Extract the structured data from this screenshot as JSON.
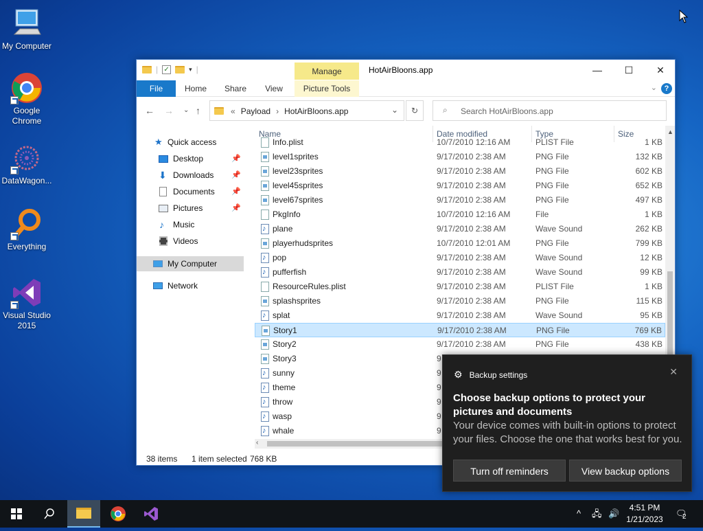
{
  "desktop": {
    "icons": [
      {
        "label": "My Computer",
        "icon": "computer-icon"
      },
      {
        "label": "Google Chrome",
        "icon": "chrome-icon"
      },
      {
        "label": "DataWagon...",
        "icon": "datawagon-icon"
      },
      {
        "label": "Everything",
        "icon": "everything-search-icon"
      },
      {
        "label": "Visual Studio 2015",
        "icon": "visual-studio-icon"
      }
    ]
  },
  "window": {
    "title": "HotAirBloons.app",
    "context_tab": "Manage",
    "ribbon_tabs": [
      "File",
      "Home",
      "Share",
      "View",
      "Picture Tools"
    ],
    "address": {
      "prefix": "«",
      "parts": [
        "Payload",
        "HotAirBloons.app"
      ]
    },
    "search_placeholder": "Search HotAirBloons.app"
  },
  "nav": {
    "items": [
      {
        "label": "Quick access",
        "icon": "star-icon",
        "pinned": false
      },
      {
        "label": "Desktop",
        "icon": "desktop-folder-icon",
        "pinned": true
      },
      {
        "label": "Downloads",
        "icon": "downloads-icon",
        "pinned": true
      },
      {
        "label": "Documents",
        "icon": "documents-icon",
        "pinned": true
      },
      {
        "label": "Pictures",
        "icon": "pictures-icon",
        "pinned": true
      },
      {
        "label": "Music",
        "icon": "music-icon",
        "pinned": false
      },
      {
        "label": "Videos",
        "icon": "videos-icon",
        "pinned": false
      },
      {
        "label": "My Computer",
        "icon": "computer-icon",
        "pinned": false
      },
      {
        "label": "Network",
        "icon": "network-icon",
        "pinned": false
      }
    ]
  },
  "files": {
    "columns": [
      "Name",
      "Date modified",
      "Type",
      "Size"
    ],
    "rows": [
      {
        "name": "Info.plist",
        "date": "10/7/2010 12:16 AM",
        "type": "PLIST File",
        "size": "1 KB",
        "kind": "doc"
      },
      {
        "name": "level1sprites",
        "date": "9/17/2010 2:38 AM",
        "type": "PNG File",
        "size": "132 KB",
        "kind": "img"
      },
      {
        "name": "level23sprites",
        "date": "9/17/2010 2:38 AM",
        "type": "PNG File",
        "size": "602 KB",
        "kind": "img"
      },
      {
        "name": "level45sprites",
        "date": "9/17/2010 2:38 AM",
        "type": "PNG File",
        "size": "652 KB",
        "kind": "img"
      },
      {
        "name": "level67sprites",
        "date": "9/17/2010 2:38 AM",
        "type": "PNG File",
        "size": "497 KB",
        "kind": "img"
      },
      {
        "name": "PkgInfo",
        "date": "10/7/2010 12:16 AM",
        "type": "File",
        "size": "1 KB",
        "kind": "doc"
      },
      {
        "name": "plane",
        "date": "9/17/2010 2:38 AM",
        "type": "Wave Sound",
        "size": "262 KB",
        "kind": "aud"
      },
      {
        "name": "playerhudsprites",
        "date": "10/7/2010 12:01 AM",
        "type": "PNG File",
        "size": "799 KB",
        "kind": "img"
      },
      {
        "name": "pop",
        "date": "9/17/2010 2:38 AM",
        "type": "Wave Sound",
        "size": "12 KB",
        "kind": "aud"
      },
      {
        "name": "pufferfish",
        "date": "9/17/2010 2:38 AM",
        "type": "Wave Sound",
        "size": "99 KB",
        "kind": "aud"
      },
      {
        "name": "ResourceRules.plist",
        "date": "9/17/2010 2:38 AM",
        "type": "PLIST File",
        "size": "1 KB",
        "kind": "doc"
      },
      {
        "name": "splashsprites",
        "date": "9/17/2010 2:38 AM",
        "type": "PNG File",
        "size": "115 KB",
        "kind": "img"
      },
      {
        "name": "splat",
        "date": "9/17/2010 2:38 AM",
        "type": "Wave Sound",
        "size": "95 KB",
        "kind": "aud"
      },
      {
        "name": "Story1",
        "date": "9/17/2010 2:38 AM",
        "type": "PNG File",
        "size": "769 KB",
        "kind": "img",
        "selected": true
      },
      {
        "name": "Story2",
        "date": "9/17/2010 2:38 AM",
        "type": "PNG File",
        "size": "438 KB",
        "kind": "img"
      },
      {
        "name": "Story3",
        "date": "9",
        "type": "",
        "size": "",
        "kind": "img"
      },
      {
        "name": "sunny",
        "date": "9",
        "type": "",
        "size": "",
        "kind": "aud"
      },
      {
        "name": "theme",
        "date": "9",
        "type": "",
        "size": "",
        "kind": "aud"
      },
      {
        "name": "throw",
        "date": "9",
        "type": "",
        "size": "",
        "kind": "aud"
      },
      {
        "name": "wasp",
        "date": "9",
        "type": "",
        "size": "",
        "kind": "aud"
      },
      {
        "name": "whale",
        "date": "9",
        "type": "",
        "size": "",
        "kind": "aud"
      }
    ]
  },
  "status": {
    "count": "38 items",
    "selected": "1 item selected",
    "size": "768 KB"
  },
  "toast": {
    "app": "Backup settings",
    "title": "Choose backup options to protect your pictures and documents",
    "body": "Your device comes with built-in options to protect your files. Choose the one that works best for you.",
    "btn_off": "Turn off reminders",
    "btn_view": "View backup options"
  },
  "taskbar": {
    "time": "4:51 PM",
    "date": "1/21/2023",
    "notifications": "2"
  },
  "colors": {
    "accent": "#1979ca",
    "selection": "#cce8ff",
    "toast_bg": "#1f1f1f"
  }
}
